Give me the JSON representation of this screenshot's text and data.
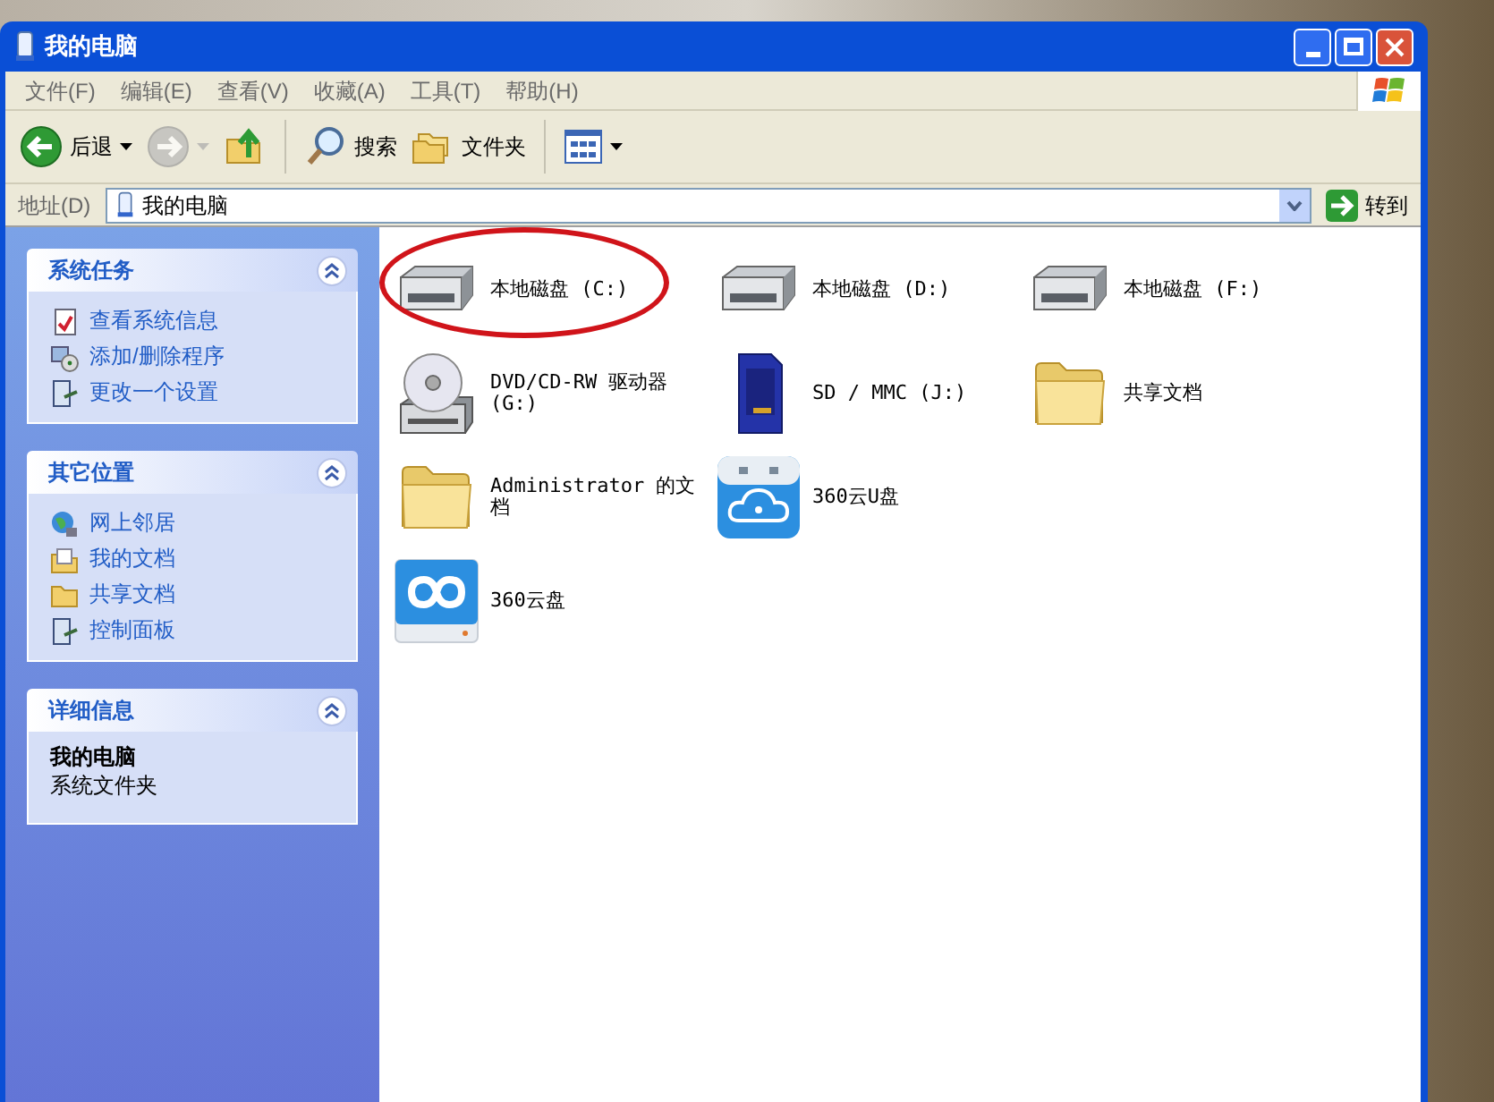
{
  "window": {
    "title": "我的电脑"
  },
  "menu": [
    "文件(F)",
    "编辑(E)",
    "查看(V)",
    "收藏(A)",
    "工具(T)",
    "帮助(H)"
  ],
  "toolbar": [
    {
      "kind": "back",
      "label": "后退",
      "disabled": false
    },
    {
      "kind": "forward",
      "disabled": true
    },
    {
      "kind": "up",
      "disabled": false
    },
    {
      "kind": "search",
      "label": "搜索",
      "disabled": false
    },
    {
      "kind": "folders",
      "label": "文件夹",
      "disabled": false
    },
    {
      "kind": "views",
      "disabled": false
    }
  ],
  "address": {
    "label": "地址(D)",
    "value": "我的电脑",
    "go": "转到"
  },
  "panels": [
    {
      "title": "系统任务",
      "expanded": true,
      "items": [
        {
          "kind": "sysinfo",
          "label": "查看系统信息"
        },
        {
          "kind": "addremove",
          "label": "添加/删除程序"
        },
        {
          "kind": "control",
          "label": "更改一个设置"
        }
      ]
    },
    {
      "title": "其它位置",
      "expanded": true,
      "items": [
        {
          "kind": "network",
          "label": "网上邻居"
        },
        {
          "kind": "mydocs",
          "label": "我的文档"
        },
        {
          "kind": "folder",
          "label": "共享文档"
        },
        {
          "kind": "control",
          "label": "控制面板"
        }
      ]
    },
    {
      "title": "详细信息",
      "expanded": true,
      "details": {
        "name": "我的电脑",
        "type": "系统文件夹"
      }
    }
  ],
  "items": [
    {
      "kind": "disk",
      "label": "本地磁盘 (C:)",
      "circled": true
    },
    {
      "kind": "disk",
      "label": "本地磁盘 (D:)",
      "circled": false
    },
    {
      "kind": "disk",
      "label": "本地磁盘 (F:)",
      "circled": false
    },
    {
      "kind": "dvd",
      "label": "DVD/CD-RW 驱动器 (G:)",
      "circled": false
    },
    {
      "kind": "sd",
      "label": "SD / MMC (J:)",
      "circled": false
    },
    {
      "kind": "folder",
      "label": "共享文档",
      "circled": false
    },
    {
      "kind": "folder",
      "label": "Administrator 的文档",
      "circled": false
    },
    {
      "kind": "usb",
      "label": "360云U盘",
      "circled": false
    },
    {
      "kind": "blank"
    },
    {
      "kind": "cloud",
      "label": "360云盘",
      "circled": false
    }
  ]
}
